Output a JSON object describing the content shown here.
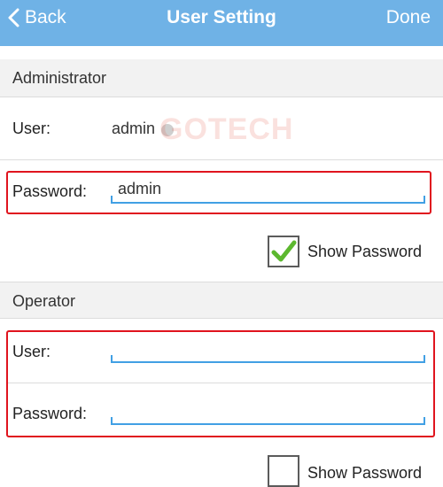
{
  "navbar": {
    "back_label": "Back",
    "title": "User Setting",
    "done_label": "Done",
    "bg_color": "#6fb2e6"
  },
  "administrator": {
    "header": "Administrator",
    "user_label": "User:",
    "user_value": "admin",
    "password_label": "Password:",
    "password_value": "admin",
    "show_password_label": "Show Password",
    "show_password_checked": true
  },
  "operator": {
    "header": "Operator",
    "user_label": "User:",
    "user_value": "",
    "password_label": "Password:",
    "password_value": "",
    "show_password_label": "Show Password",
    "show_password_checked": false
  },
  "watermark": "GOTECH",
  "colors": {
    "accent_line": "#41a0e4",
    "highlight_border": "#e0141e",
    "check_green": "#5cb82f"
  }
}
